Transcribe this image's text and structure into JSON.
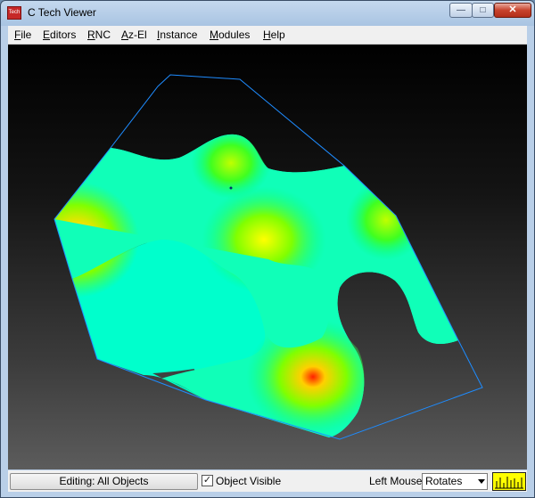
{
  "window": {
    "title": "C Tech Viewer",
    "app_icon_text": "Tech",
    "controls": {
      "minimize": "—",
      "maximize": "□",
      "close": "✕"
    }
  },
  "menu": [
    "File",
    "Editors",
    "RNC",
    "Az-El",
    "Instance",
    "Modules",
    "Help"
  ],
  "viewport": {
    "scene": "3d-contour-surface",
    "background": "#000000",
    "boundary_color": "#1e8cff",
    "colormap": [
      "#00ffff",
      "#00ff80",
      "#80ff00",
      "#ffff00",
      "#ff8000",
      "#ff0000"
    ]
  },
  "status": {
    "editing_button": "Editing: All Objects",
    "object_visible_label": "Object Visible",
    "object_visible_checked": true,
    "left_mouse_label": "Left Mouse",
    "left_mouse_value": "Rotates",
    "meter_color": "#ffff00"
  }
}
